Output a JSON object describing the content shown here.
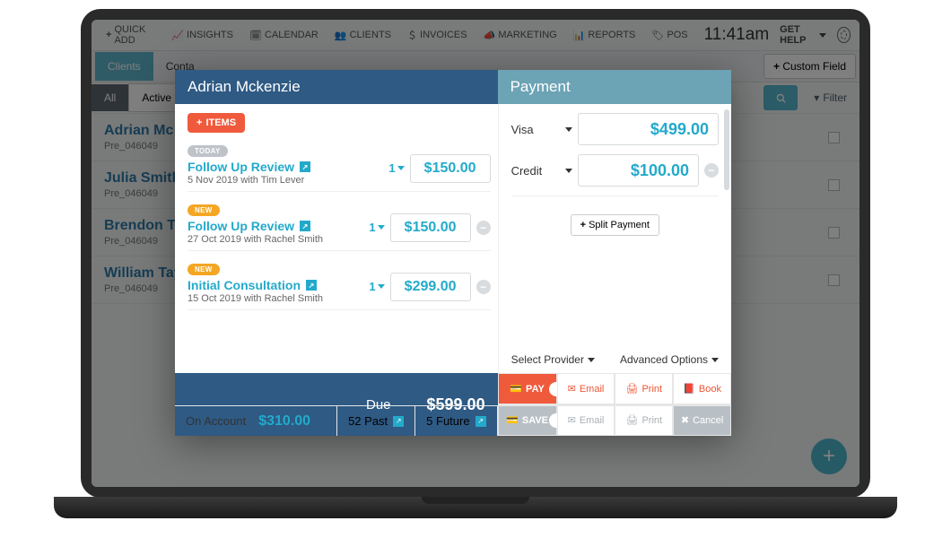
{
  "menubar": {
    "items": [
      {
        "icon": "+",
        "label": "QUICK ADD"
      },
      {
        "icon": "📈",
        "label": "INSIGHTS"
      },
      {
        "icon": "🗓",
        "label": "CALENDAR"
      },
      {
        "icon": "👥",
        "label": "CLIENTS"
      },
      {
        "icon": "＄",
        "label": "INVOICES"
      },
      {
        "icon": "📣",
        "label": "MARKETING"
      },
      {
        "icon": "📊",
        "label": "REPORTS"
      },
      {
        "icon": "🏷",
        "label": "POS"
      }
    ],
    "clock": "11:41am",
    "help": "GET HELP"
  },
  "tabs": {
    "active": "Clients",
    "second": "Conta",
    "custom_field": "Custom Field"
  },
  "filters": {
    "all": "All",
    "active": "Active",
    "filter": "Filter"
  },
  "clients": [
    {
      "name": "Adrian Mc",
      "sub": "Pre_046049"
    },
    {
      "name": "Julia Smith",
      "sub": "Pre_046049"
    },
    {
      "name": "Brendon Th",
      "sub": "Pre_046049"
    },
    {
      "name": "William Tayl",
      "sub": "Pre_046049"
    }
  ],
  "modal": {
    "title_left": "Adrian Mckenzie",
    "title_right": "Payment",
    "items_btn": "ITEMS",
    "services": [
      {
        "badge": "TODAY",
        "badge_class": "",
        "title": "Follow Up Review",
        "sub": "5 Nov 2019 with Tim Lever",
        "qty": "1",
        "amount": "$150.00",
        "remove": false
      },
      {
        "badge": "NEW",
        "badge_class": "new",
        "title": "Follow Up Review",
        "sub": "27 Oct 2019 with Rachel Smith",
        "qty": "1",
        "amount": "$150.00",
        "remove": true
      },
      {
        "badge": "NEW",
        "badge_class": "new",
        "title": "Initial Consultation",
        "sub": "15 Oct 2019 with Rachel Smith",
        "qty": "1",
        "amount": "$299.00",
        "remove": true
      }
    ],
    "payments": [
      {
        "method": "Visa",
        "amount": "$499.00",
        "remove": false
      },
      {
        "method": "Credit",
        "amount": "$100.00",
        "remove": true
      }
    ],
    "split": "Split Payment",
    "provider": "Select Provider",
    "advanced": "Advanced Options",
    "due_label": "Due",
    "due_amount": "$599.00",
    "on_account_label": "On Account",
    "on_account_amount": "$310.00",
    "past": "52 Past",
    "future": "5 Future",
    "actions": {
      "pay": "PAY",
      "save": "SAVE",
      "email": "Email",
      "print": "Print",
      "book": "Book",
      "cancel": "Cancel"
    }
  }
}
